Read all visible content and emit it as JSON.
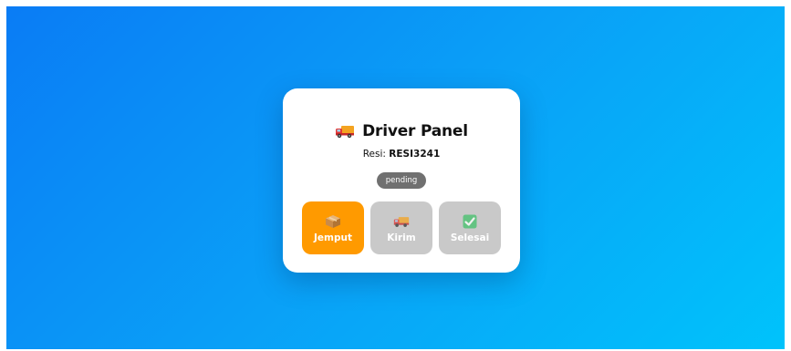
{
  "panel": {
    "title": "Driver Panel",
    "title_icon": "delivery-truck-icon",
    "resi_label": "Resi:",
    "resi_value": "RESI3241",
    "status": "pending"
  },
  "actions": [
    {
      "label": "Jemput",
      "icon": "package-box-icon",
      "color": "#ff9a00",
      "active": true
    },
    {
      "label": "Kirim",
      "icon": "delivery-truck-icon",
      "color": "#c9c9c9",
      "active": false
    },
    {
      "label": "Selesai",
      "icon": "check-mark-icon",
      "color": "#c9c9c9",
      "active": false
    }
  ],
  "colors": {
    "background_start": "#0a7cf5",
    "background_end": "#00c3fb",
    "status_badge": "#707070",
    "accent": "#ff9a00"
  }
}
